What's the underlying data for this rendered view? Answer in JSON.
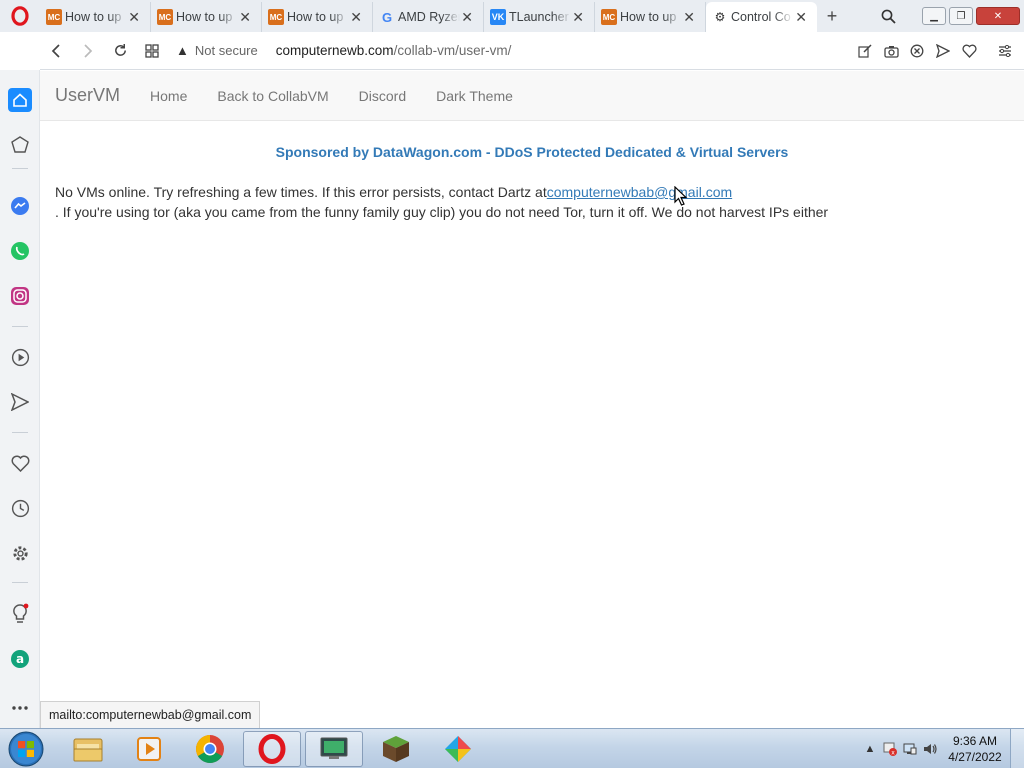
{
  "browser": {
    "tabs": [
      {
        "icon": "minecraft-favicon-icon",
        "title": "How to up"
      },
      {
        "icon": "minecraft-favicon-icon",
        "title": "How to up"
      },
      {
        "icon": "minecraft-favicon-icon",
        "title": "How to up"
      },
      {
        "icon": "google-favicon-icon",
        "title": "AMD Ryzen"
      },
      {
        "icon": "vk-favicon-icon",
        "title": "TLauncher"
      },
      {
        "icon": "minecraft-favicon-icon",
        "title": "How to up"
      },
      {
        "icon": "collabvm-favicon-icon",
        "title": "Control Co"
      }
    ],
    "fav_labels": {
      "mc": "MC",
      "vk": "VK",
      "google": "G"
    },
    "address": {
      "security_text": "Not secure",
      "url_host": "computernewb.com",
      "url_path": "/collab-vm/user-vm/"
    },
    "status_link": "mailto:computernewbab@gmail.com"
  },
  "site": {
    "brand": "UserVM",
    "nav": [
      "Home",
      "Back to CollabVM",
      "Discord",
      "Dark Theme"
    ],
    "sponsor": "Sponsored by DataWagon.com - DDoS Protected Dedicated & Virtual Servers",
    "message_before": "No VMs online. Try refreshing a few times. If this error persists, contact Dartz at",
    "email": "computernewbab@gmail.com",
    "message_after": ". If you're using tor (aka you came from the funny family guy clip) you do not need Tor, turn it off. We do not harvest IPs either"
  },
  "taskbar": {
    "time": "9:36 AM",
    "date": "4/27/2022"
  },
  "colors": {
    "link": "#337ab7",
    "opera_red": "#e0161e",
    "close_button": "#c8423b"
  }
}
